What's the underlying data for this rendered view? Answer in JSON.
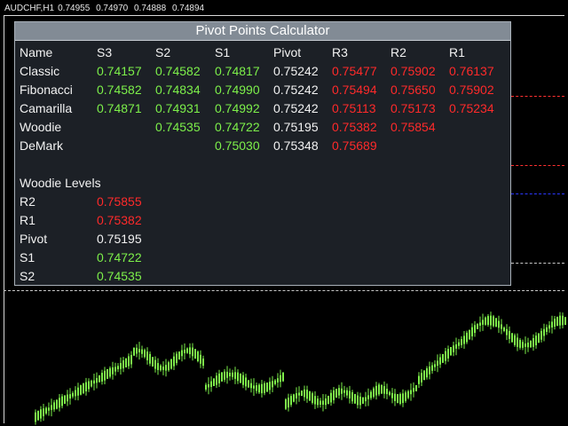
{
  "chart": {
    "symbol_tf": "AUDCHF,H1",
    "prices": [
      "0.74955",
      "0.74970",
      "0.74888",
      "0.74894"
    ],
    "colors": {
      "background": "#000000",
      "candle": "#7df04a",
      "frame": "#d8d8d8"
    }
  },
  "calculator": {
    "title": "Pivot Points Calculator",
    "headers": [
      "Name",
      "S3",
      "S2",
      "S1",
      "Pivot",
      "R3",
      "R2",
      "R1"
    ],
    "rows": [
      {
        "name": "Classic",
        "values": [
          "0.74157",
          "0.74582",
          "0.74817",
          "0.75242",
          "0.75477",
          "0.75902",
          "0.76137"
        ]
      },
      {
        "name": "Fibonacci",
        "values": [
          "0.74582",
          "0.74834",
          "0.74990",
          "0.75242",
          "0.75494",
          "0.75650",
          "0.75902"
        ]
      },
      {
        "name": "Camarilla",
        "values": [
          "0.74871",
          "0.74931",
          "0.74992",
          "0.75242",
          "0.75113",
          "0.75173",
          "0.75234"
        ]
      },
      {
        "name": "Woodie",
        "values": [
          "",
          "0.74535",
          "0.74722",
          "0.75195",
          "0.75382",
          "0.75854",
          ""
        ]
      },
      {
        "name": "DeMark",
        "values": [
          "",
          "",
          "0.75030",
          "0.75348",
          "0.75689",
          "",
          ""
        ]
      }
    ],
    "woodie": {
      "title": "Woodie Levels",
      "levels": [
        {
          "label": "R2",
          "value": "0.75855"
        },
        {
          "label": "R1",
          "value": "0.75382"
        },
        {
          "label": "Pivot",
          "value": "0.75195"
        },
        {
          "label": "S1",
          "value": "0.74722"
        },
        {
          "label": "S2",
          "value": "0.74535"
        }
      ]
    },
    "colors": {
      "support": "#7df04a",
      "resistance": "#ff2a2a",
      "pivot": "#f2f2f2",
      "panel": "#1c2026",
      "title_bar": "#828b95"
    }
  }
}
